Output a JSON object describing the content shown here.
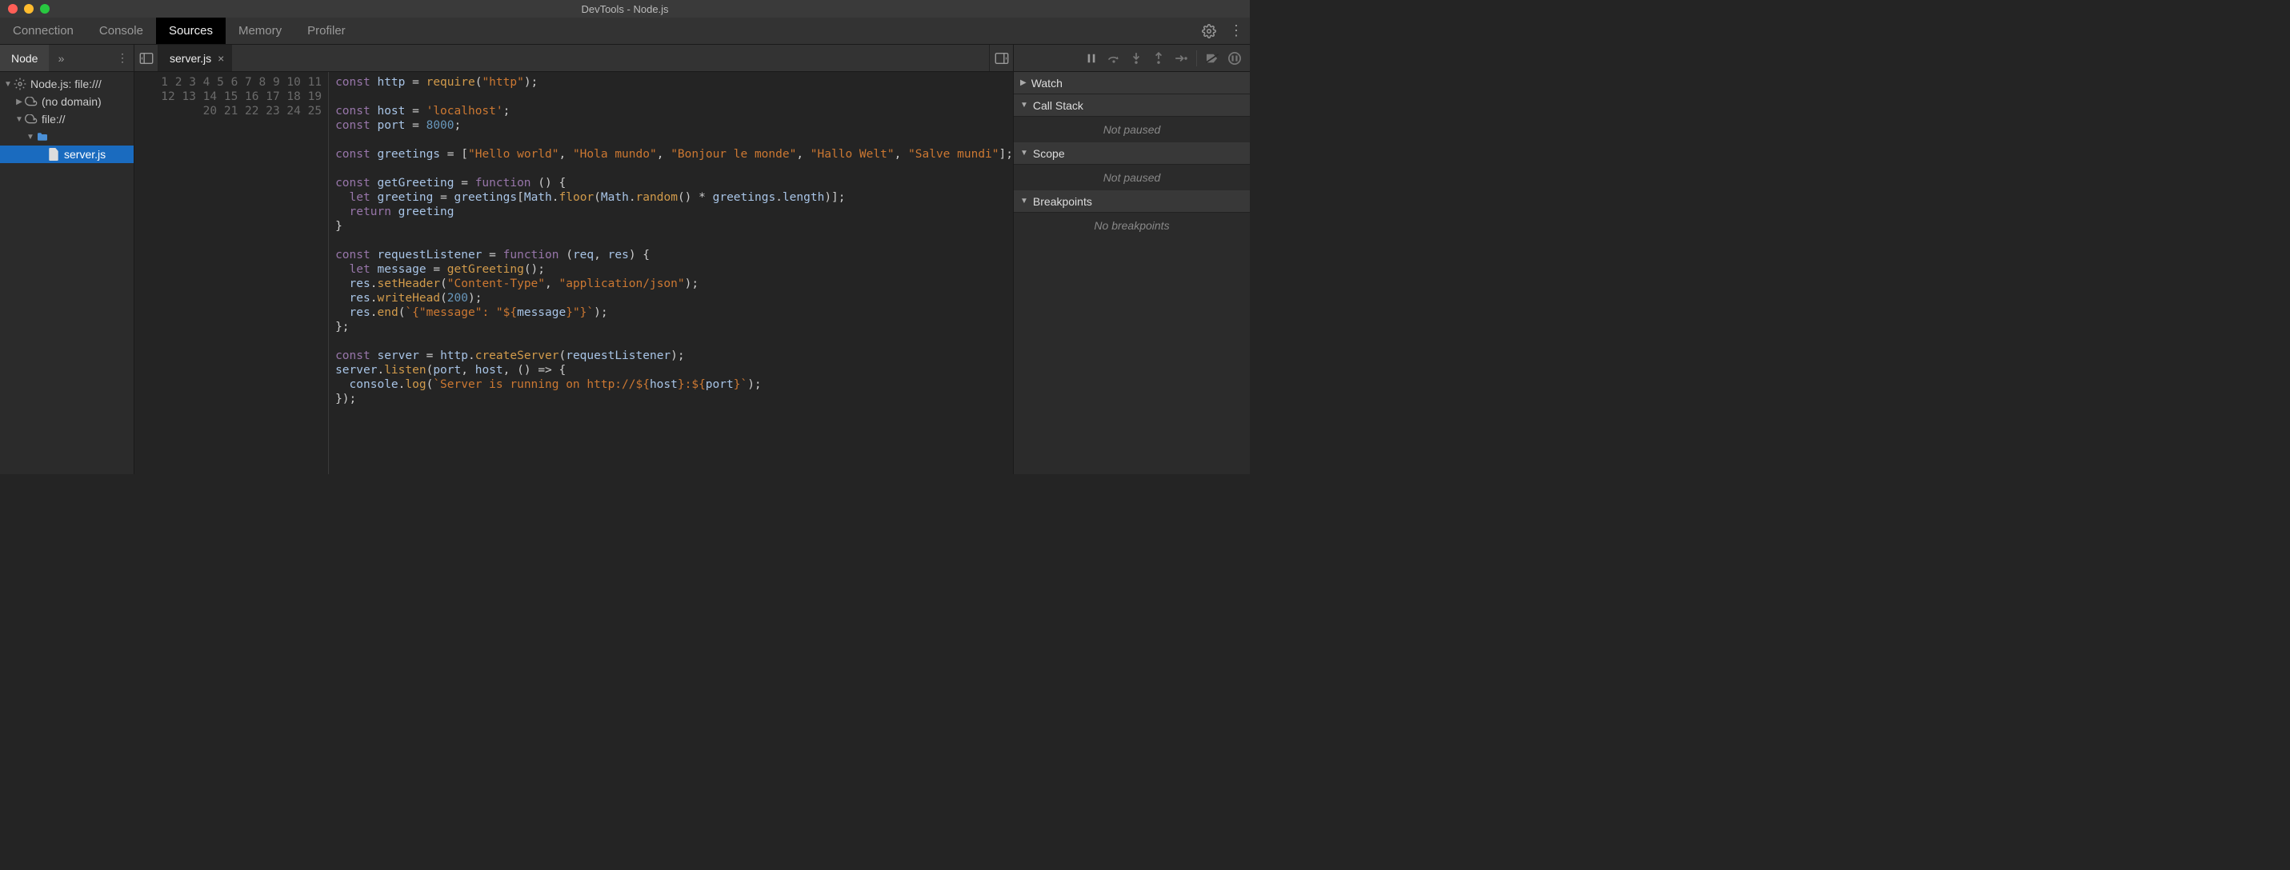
{
  "window": {
    "title": "DevTools - Node.js"
  },
  "mainTabs": [
    "Connection",
    "Console",
    "Sources",
    "Memory",
    "Profiler"
  ],
  "mainTabActive": "Sources",
  "sidebar": {
    "tab": "Node",
    "tree": {
      "root": "Node.js: file:///",
      "noDomain": "(no domain)",
      "fileScheme": "file://",
      "file": "server.js"
    }
  },
  "editor": {
    "openFile": "server.js",
    "lineCount": 25,
    "code": {
      "lines": [
        [
          [
            "kw",
            "const"
          ],
          [
            "",
            ""
          ],
          [
            "name",
            "http"
          ],
          [
            "",
            ""
          ],
          [
            "op",
            "="
          ],
          [
            "",
            ""
          ],
          [
            "fn",
            "require"
          ],
          [
            "punc",
            "("
          ],
          [
            "str",
            "\"http\""
          ],
          [
            "punc",
            ");"
          ]
        ],
        [],
        [
          [
            "kw",
            "const"
          ],
          [
            "",
            ""
          ],
          [
            "name",
            "host"
          ],
          [
            "",
            ""
          ],
          [
            "op",
            "="
          ],
          [
            "",
            ""
          ],
          [
            "str",
            "'localhost'"
          ],
          [
            "punc",
            ";"
          ]
        ],
        [
          [
            "kw",
            "const"
          ],
          [
            "",
            ""
          ],
          [
            "name",
            "port"
          ],
          [
            "",
            ""
          ],
          [
            "op",
            "="
          ],
          [
            "",
            ""
          ],
          [
            "num",
            "8000"
          ],
          [
            "punc",
            ";"
          ]
        ],
        [],
        [
          [
            "kw",
            "const"
          ],
          [
            "",
            ""
          ],
          [
            "name",
            "greetings"
          ],
          [
            "",
            ""
          ],
          [
            "op",
            "="
          ],
          [
            "",
            ""
          ],
          [
            "punc",
            "["
          ],
          [
            "str",
            "\"Hello world\""
          ],
          [
            "punc",
            ","
          ],
          [
            "",
            ""
          ],
          [
            "str",
            "\"Hola mundo\""
          ],
          [
            "punc",
            ","
          ],
          [
            "",
            ""
          ],
          [
            "str",
            "\"Bonjour le monde\""
          ],
          [
            "punc",
            ","
          ],
          [
            "",
            ""
          ],
          [
            "str",
            "\"Hallo Welt\""
          ],
          [
            "punc",
            ","
          ],
          [
            "",
            ""
          ],
          [
            "str",
            "\"Salve mundi\""
          ],
          [
            "punc",
            "];"
          ]
        ],
        [],
        [
          [
            "kw",
            "const"
          ],
          [
            "",
            ""
          ],
          [
            "name",
            "getGreeting"
          ],
          [
            "",
            ""
          ],
          [
            "op",
            "="
          ],
          [
            "",
            ""
          ],
          [
            "kw",
            "function"
          ],
          [
            "",
            ""
          ],
          [
            "punc",
            "()"
          ],
          [
            "",
            ""
          ],
          [
            "punc",
            "{"
          ]
        ],
        [
          [
            "",
            "  "
          ],
          [
            "kw",
            "let"
          ],
          [
            "",
            ""
          ],
          [
            "name",
            "greeting"
          ],
          [
            "",
            ""
          ],
          [
            "op",
            "="
          ],
          [
            "",
            ""
          ],
          [
            "name",
            "greetings"
          ],
          [
            "punc",
            "["
          ],
          [
            "name",
            "Math"
          ],
          [
            "punc",
            "."
          ],
          [
            "fn",
            "floor"
          ],
          [
            "punc",
            "("
          ],
          [
            "name",
            "Math"
          ],
          [
            "punc",
            "."
          ],
          [
            "fn",
            "random"
          ],
          [
            "punc",
            "()"
          ],
          [
            "",
            ""
          ],
          [
            "op",
            "*"
          ],
          [
            "",
            ""
          ],
          [
            "name",
            "greetings"
          ],
          [
            "punc",
            "."
          ],
          [
            "name",
            "length"
          ],
          [
            "punc",
            ")];"
          ]
        ],
        [
          [
            "",
            "  "
          ],
          [
            "kw",
            "return"
          ],
          [
            "",
            ""
          ],
          [
            "name",
            "greeting"
          ]
        ],
        [
          [
            "punc",
            "}"
          ]
        ],
        [],
        [
          [
            "kw",
            "const"
          ],
          [
            "",
            ""
          ],
          [
            "name",
            "requestListener"
          ],
          [
            "",
            ""
          ],
          [
            "op",
            "="
          ],
          [
            "",
            ""
          ],
          [
            "kw",
            "function"
          ],
          [
            "",
            ""
          ],
          [
            "punc",
            "("
          ],
          [
            "name",
            "req"
          ],
          [
            "punc",
            ","
          ],
          [
            "",
            ""
          ],
          [
            "name",
            "res"
          ],
          [
            "punc",
            ")"
          ],
          [
            "",
            ""
          ],
          [
            "punc",
            "{"
          ]
        ],
        [
          [
            "",
            "  "
          ],
          [
            "kw",
            "let"
          ],
          [
            "",
            ""
          ],
          [
            "name",
            "message"
          ],
          [
            "",
            ""
          ],
          [
            "op",
            "="
          ],
          [
            "",
            ""
          ],
          [
            "fn",
            "getGreeting"
          ],
          [
            "punc",
            "();"
          ]
        ],
        [
          [
            "",
            "  "
          ],
          [
            "name",
            "res"
          ],
          [
            "punc",
            "."
          ],
          [
            "fn",
            "setHeader"
          ],
          [
            "punc",
            "("
          ],
          [
            "str",
            "\"Content-Type\""
          ],
          [
            "punc",
            ","
          ],
          [
            "",
            ""
          ],
          [
            "str",
            "\"application/json\""
          ],
          [
            "punc",
            ");"
          ]
        ],
        [
          [
            "",
            "  "
          ],
          [
            "name",
            "res"
          ],
          [
            "punc",
            "."
          ],
          [
            "fn",
            "writeHead"
          ],
          [
            "punc",
            "("
          ],
          [
            "num",
            "200"
          ],
          [
            "punc",
            ");"
          ]
        ],
        [
          [
            "",
            "  "
          ],
          [
            "name",
            "res"
          ],
          [
            "punc",
            "."
          ],
          [
            "fn",
            "end"
          ],
          [
            "punc",
            "("
          ],
          [
            "str",
            "`{\"message\": \"${"
          ],
          [
            "name",
            "message"
          ],
          [
            "str",
            "}\"}`"
          ],
          [
            "punc",
            ");"
          ]
        ],
        [
          [
            "punc",
            "};"
          ]
        ],
        [],
        [
          [
            "kw",
            "const"
          ],
          [
            "",
            ""
          ],
          [
            "name",
            "server"
          ],
          [
            "",
            ""
          ],
          [
            "op",
            "="
          ],
          [
            "",
            ""
          ],
          [
            "name",
            "http"
          ],
          [
            "punc",
            "."
          ],
          [
            "fn",
            "createServer"
          ],
          [
            "punc",
            "("
          ],
          [
            "name",
            "requestListener"
          ],
          [
            "punc",
            ");"
          ]
        ],
        [
          [
            "name",
            "server"
          ],
          [
            "punc",
            "."
          ],
          [
            "fn",
            "listen"
          ],
          [
            "punc",
            "("
          ],
          [
            "name",
            "port"
          ],
          [
            "punc",
            ","
          ],
          [
            "",
            ""
          ],
          [
            "name",
            "host"
          ],
          [
            "punc",
            ","
          ],
          [
            "",
            ""
          ],
          [
            "punc",
            "()"
          ],
          [
            "",
            ""
          ],
          [
            "op",
            "=>"
          ],
          [
            "",
            ""
          ],
          [
            "punc",
            "{"
          ]
        ],
        [
          [
            "",
            "  "
          ],
          [
            "name",
            "console"
          ],
          [
            "punc",
            "."
          ],
          [
            "fn",
            "log"
          ],
          [
            "punc",
            "("
          ],
          [
            "str",
            "`Server is running on http://${"
          ],
          [
            "name",
            "host"
          ],
          [
            "str",
            "}:${"
          ],
          [
            "name",
            "port"
          ],
          [
            "str",
            "}`"
          ],
          [
            "punc",
            ");"
          ]
        ],
        [
          [
            "punc",
            "});"
          ]
        ],
        [],
        []
      ]
    }
  },
  "debug": {
    "watch": "Watch",
    "callStack": "Call Stack",
    "callStackBody": "Not paused",
    "scope": "Scope",
    "scopeBody": "Not paused",
    "breakpoints": "Breakpoints",
    "breakpointsBody": "No breakpoints"
  }
}
